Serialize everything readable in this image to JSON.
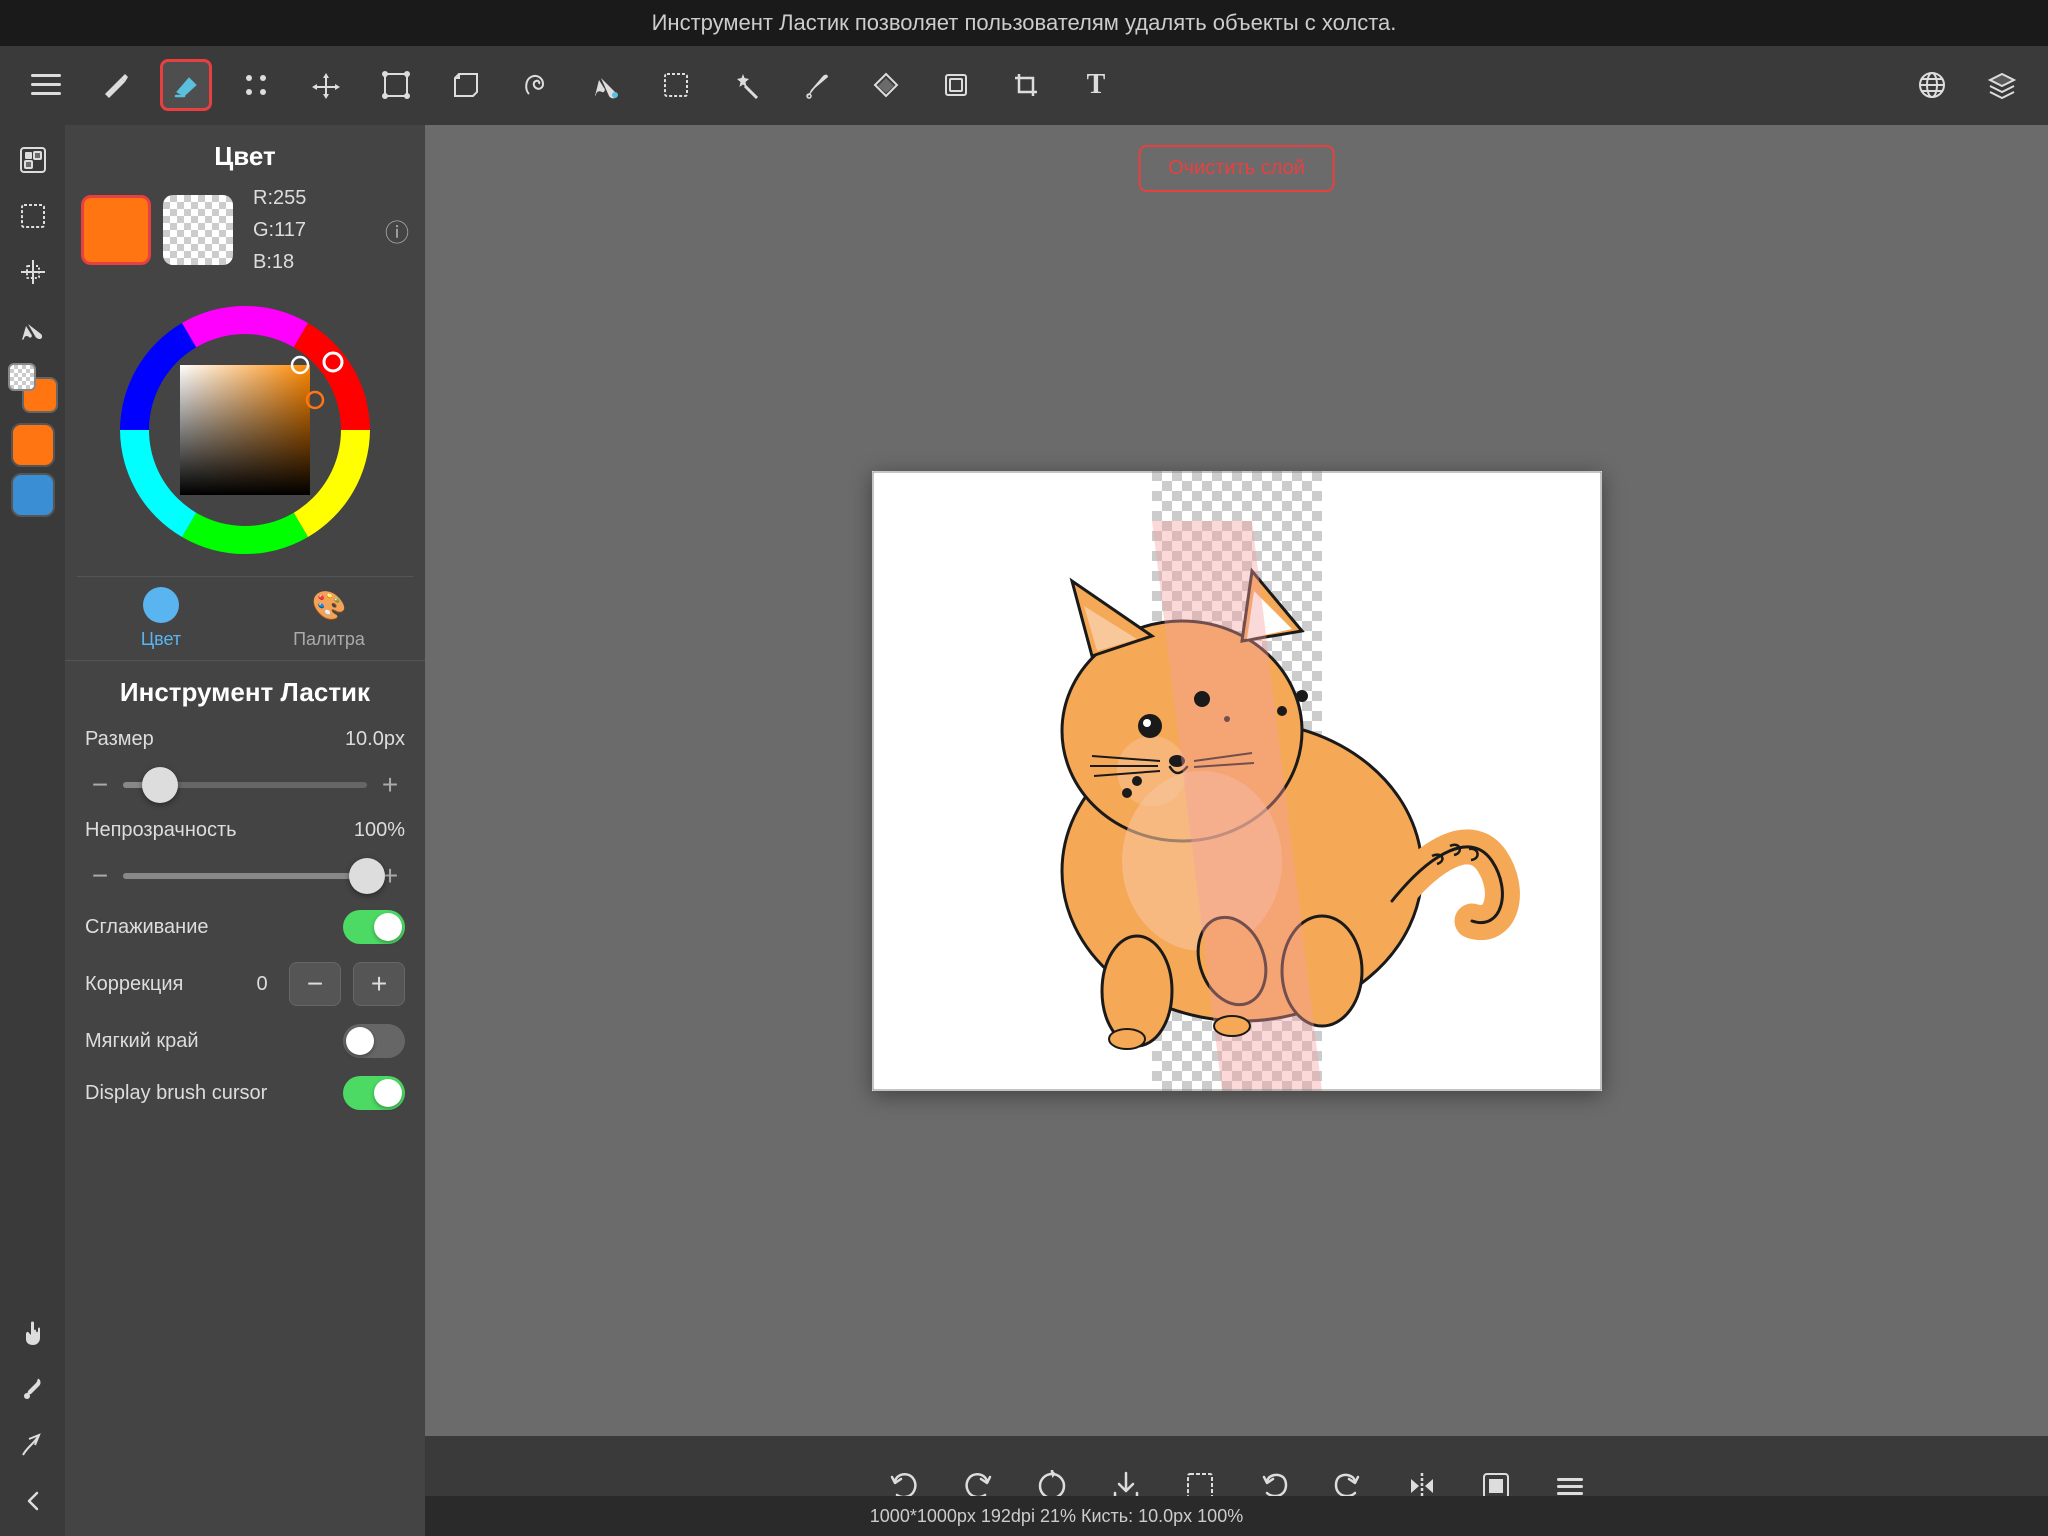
{
  "topbar": {
    "text": "Инструмент Ластик позволяет пользователям удалять объекты с холста."
  },
  "toolbar": {
    "tools": [
      {
        "id": "menu",
        "symbol": "≡"
      },
      {
        "id": "pencil",
        "symbol": "✏"
      },
      {
        "id": "eraser",
        "symbol": "◆",
        "active": true
      },
      {
        "id": "select-paint",
        "symbol": "⌖"
      },
      {
        "id": "move",
        "symbol": "✛"
      },
      {
        "id": "transform",
        "symbol": "⬚"
      },
      {
        "id": "free-transform",
        "symbol": "⬚"
      },
      {
        "id": "lasso",
        "symbol": "⬡"
      },
      {
        "id": "fill",
        "symbol": "⬡"
      },
      {
        "id": "rectangle",
        "symbol": "▭"
      },
      {
        "id": "magic-wand",
        "symbol": "⊹"
      },
      {
        "id": "pen-tool",
        "symbol": "✒"
      },
      {
        "id": "gradient",
        "symbol": "◇"
      },
      {
        "id": "layers",
        "symbol": "▣"
      },
      {
        "id": "crop",
        "symbol": "⌞"
      },
      {
        "id": "text",
        "symbol": "T"
      },
      {
        "id": "globe",
        "symbol": "🌐"
      },
      {
        "id": "stacks",
        "symbol": "⊞"
      }
    ]
  },
  "colorPanel": {
    "title": "Цвет",
    "primaryColor": "#ff7512",
    "r": 255,
    "g": 117,
    "b": 18,
    "rgb_label": "R:255\nG:117\nB:18",
    "tabs": [
      {
        "id": "color",
        "label": "Цвет",
        "active": true
      },
      {
        "id": "palette",
        "label": "Палитра",
        "active": false
      }
    ]
  },
  "toolSettings": {
    "title": "Инструмент Ластик",
    "size": {
      "label": "Размер",
      "value": "10.0px",
      "percent": 15
    },
    "opacity": {
      "label": "Непрозрачность",
      "value": "100%",
      "percent": 100
    },
    "smoothing": {
      "label": "Сглаживание",
      "enabled": true
    },
    "correction": {
      "label": "Коррекция",
      "value": "0"
    },
    "softEdge": {
      "label": "Мягкий край",
      "enabled": false
    },
    "displayBrushCursor": {
      "label": "Display brush cursor",
      "enabled": true
    }
  },
  "clearButton": {
    "label": "Очистить слой"
  },
  "bottomToolbar": {
    "tools": [
      {
        "id": "undo",
        "symbol": "↩"
      },
      {
        "id": "redo",
        "symbol": "↪"
      },
      {
        "id": "rotate-canvas",
        "symbol": "↻"
      },
      {
        "id": "download",
        "symbol": "⬇"
      },
      {
        "id": "select-rect",
        "symbol": "▭"
      },
      {
        "id": "rotate-ccw",
        "symbol": "↺"
      },
      {
        "id": "rotate-cw",
        "symbol": "↻"
      },
      {
        "id": "flip",
        "symbol": "⇌"
      },
      {
        "id": "edit",
        "symbol": "✎"
      },
      {
        "id": "menu2",
        "symbol": "≡"
      }
    ]
  },
  "statusBar": {
    "text": "1000*1000px 192dpi 21% Кисть: 10.0px 100%"
  },
  "leftTools": [
    {
      "id": "layers-panel",
      "symbol": "▣"
    },
    {
      "id": "selection",
      "symbol": "⬚"
    },
    {
      "id": "transform2",
      "symbol": "✛"
    },
    {
      "id": "brush",
      "symbol": "✏"
    },
    {
      "id": "color-swatch",
      "symbol": "",
      "isSwatch": true
    },
    {
      "id": "layers2",
      "symbol": "▣"
    },
    {
      "id": "hand",
      "symbol": "✋"
    },
    {
      "id": "eyedropper",
      "symbol": "💉"
    },
    {
      "id": "share",
      "symbol": "↗"
    },
    {
      "id": "back",
      "symbol": "←"
    }
  ]
}
